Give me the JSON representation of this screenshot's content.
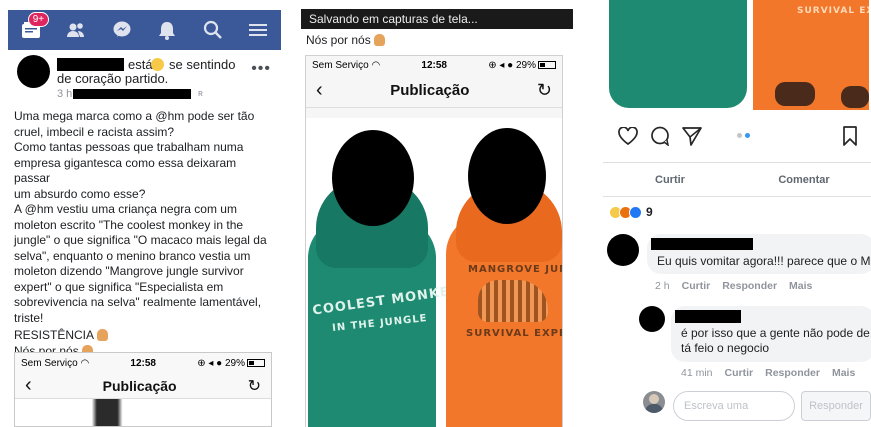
{
  "panel1": {
    "nav": {
      "badge": "9+",
      "icons": [
        "home-icon",
        "friends-icon",
        "messenger-icon",
        "notifications-icon",
        "search-icon",
        "menu-icon"
      ]
    },
    "post": {
      "status_text": "está",
      "feeling_text": "se sentindo",
      "feeling_value": "de coração partido.",
      "time": "3 h",
      "text_lines": [
        "Uma mega marca como a @hm pode ser tão",
        "cruel, imbecil e racista assim?",
        "Como tantas pessoas que trabalham numa",
        "empresa gigantesca como essa deixaram passar",
        "um absurdo como esse?",
        "A @hm vestiu uma criança negra com um",
        "moleton escrito \"The coolest monkey in the",
        "jungle\" o que significa \"O macaco mais legal da",
        "selva\", enquanto o menino branco vestia um",
        "moleton dizendo \"Mangrove jungle survivor",
        "expert\" o que significa \"Especialista em",
        "sobrevivencia na selva\" realmente lamentável,",
        "triste!"
      ],
      "resistance": "RESISTÊNCIA",
      "nos_por_nos": "Nós por nós"
    },
    "embed": {
      "carrier": "Sem Serviço",
      "time": "12:58",
      "battery": "29%",
      "title": "Publicação"
    }
  },
  "panel2": {
    "toast": "Salvando em capturas de tela...",
    "nos_por_nos": "Nós por nós",
    "status": {
      "carrier": "Sem Serviço",
      "time": "12:58",
      "battery": "29%"
    },
    "title": "Publicação",
    "hoodie_green": [
      "COOLEST MONKE",
      "IN THE JUNGLE"
    ],
    "hoodie_orange": [
      "MANGROVE JUN",
      "SURVIVAL EXPER",
      "SURVIVAL EXPERT"
    ]
  },
  "panel3": {
    "hoodie_top": "SURVIVAL EXPE",
    "actions": {
      "like": "Curtir",
      "comment": "Comentar"
    },
    "reaction_count": "9",
    "comments": [
      {
        "text": "Eu quis vomitar agora!!! parece que o Mu",
        "time": "2 h",
        "like": "Curtir",
        "reply": "Responder",
        "more": "Mais"
      },
      {
        "text": "é por isso que a gente não pode de tá feio o negocio",
        "time": "41 min",
        "like": "Curtir",
        "reply": "Responder",
        "more": "Mais"
      }
    ],
    "reply_placeholder": "Escreva uma",
    "reply_button": "Responder",
    "colors": {
      "fb_blue": "#3b5998",
      "hoodie_green": "#1f8a72",
      "hoodie_orange": "#f2772a",
      "ig_blue": "#3897f0"
    }
  }
}
